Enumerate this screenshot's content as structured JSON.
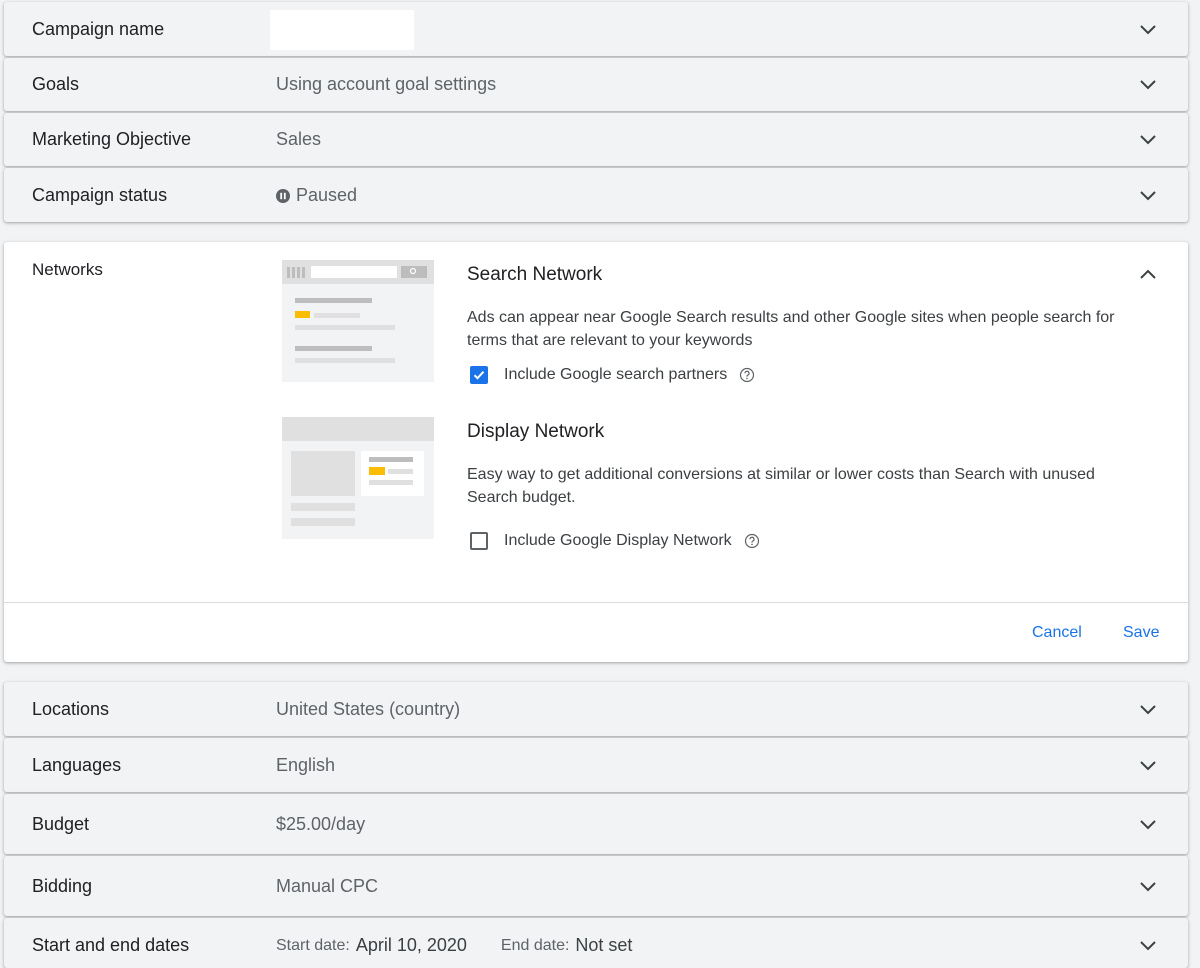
{
  "rows_top": [
    {
      "label": "Campaign name",
      "value": ""
    },
    {
      "label": "Goals",
      "value": "Using account goal settings"
    },
    {
      "label": "Marketing Objective",
      "value": "Sales"
    },
    {
      "label": "Campaign status",
      "value": "Paused",
      "icon": "pause-icon"
    }
  ],
  "networks": {
    "label": "Networks",
    "search": {
      "title": "Search Network",
      "description": "Ads can appear near Google Search results and other Google sites when people search for terms that are relevant to your keywords",
      "checkbox_label": "Include Google search partners",
      "checked": true
    },
    "display": {
      "title": "Display Network",
      "description": "Easy way to get additional conversions at similar or lower costs than Search with unused Search budget.",
      "checkbox_label": "Include Google Display Network",
      "checked": false
    },
    "cancel_label": "Cancel",
    "save_label": "Save"
  },
  "rows_bottom": [
    {
      "label": "Locations",
      "value": "United States (country)"
    },
    {
      "label": "Languages",
      "value": "English"
    },
    {
      "label": "Budget",
      "value": "$25.00/day"
    },
    {
      "label": "Bidding",
      "value": "Manual CPC"
    }
  ],
  "dates": {
    "label": "Start and end dates",
    "start_prefix": "Start date:",
    "start_value": "April 10, 2020",
    "end_prefix": "End date:",
    "end_value": "Not set"
  },
  "colors": {
    "accent": "#1a73e8",
    "illustration_highlight": "#fbbc04"
  }
}
